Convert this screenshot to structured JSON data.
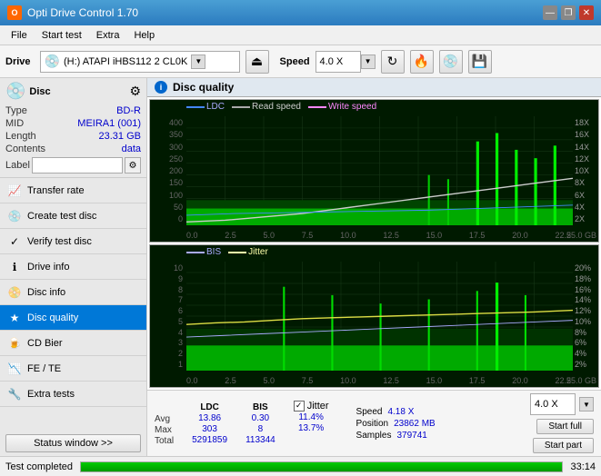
{
  "titlebar": {
    "title": "Opti Drive Control 1.70",
    "icon": "O",
    "min": "—",
    "max": "❐",
    "close": "✕"
  },
  "menubar": {
    "items": [
      "File",
      "Start test",
      "Extra",
      "Help"
    ]
  },
  "toolbar": {
    "drive_label": "Drive",
    "drive_value": "(H:) ATAPI iHBS112  2 CL0K",
    "drive_icon": "💿",
    "speed_label": "Speed",
    "speed_value": "4.0 X"
  },
  "sidebar": {
    "disc": {
      "header": "Disc",
      "rows": [
        {
          "label": "Type",
          "value": "BD-R"
        },
        {
          "label": "MID",
          "value": "MEIRA1 (001)"
        },
        {
          "label": "Length",
          "value": "23.31 GB"
        },
        {
          "label": "Contents",
          "value": "data"
        },
        {
          "label": "Label",
          "value": ""
        }
      ]
    },
    "nav_items": [
      {
        "id": "transfer-rate",
        "label": "Transfer rate",
        "icon": "📈"
      },
      {
        "id": "create-test-disc",
        "label": "Create test disc",
        "icon": "💿"
      },
      {
        "id": "verify-test-disc",
        "label": "Verify test disc",
        "icon": "✓"
      },
      {
        "id": "drive-info",
        "label": "Drive info",
        "icon": "ℹ"
      },
      {
        "id": "disc-info",
        "label": "Disc info",
        "icon": "📀"
      },
      {
        "id": "disc-quality",
        "label": "Disc quality",
        "icon": "★",
        "active": true
      },
      {
        "id": "cd-bier",
        "label": "CD Bier",
        "icon": "🍺"
      },
      {
        "id": "fe-te",
        "label": "FE / TE",
        "icon": "📉"
      },
      {
        "id": "extra-tests",
        "label": "Extra tests",
        "icon": "🔧"
      }
    ],
    "status_window_btn": "Status window >>"
  },
  "disc_quality": {
    "title": "Disc quality",
    "chart1": {
      "legend": [
        {
          "label": "LDC",
          "color": "#4488ff"
        },
        {
          "label": "Read speed",
          "color": "#aaaaaa"
        },
        {
          "label": "Write speed",
          "color": "#ff88ff"
        }
      ],
      "y_axis_left": [
        "400",
        "350",
        "300",
        "250",
        "200",
        "150",
        "100",
        "50",
        "0"
      ],
      "y_axis_right": [
        "18X",
        "16X",
        "14X",
        "12X",
        "10X",
        "8X",
        "6X",
        "4X",
        "2X"
      ],
      "x_axis": [
        "0.0",
        "2.5",
        "5.0",
        "7.5",
        "10.0",
        "12.5",
        "15.0",
        "17.5",
        "20.0",
        "22.5",
        "25.0"
      ],
      "x_unit": "GB"
    },
    "chart2": {
      "legend": [
        {
          "label": "BIS",
          "color": "#aaaaff"
        },
        {
          "label": "Jitter",
          "color": "#ffffaa"
        }
      ],
      "y_axis_left": [
        "10",
        "9",
        "8",
        "7",
        "6",
        "5",
        "4",
        "3",
        "2",
        "1"
      ],
      "y_axis_right": [
        "20%",
        "18%",
        "16%",
        "14%",
        "12%",
        "10%",
        "8%",
        "6%",
        "4%",
        "2%"
      ],
      "x_axis": [
        "0.0",
        "2.5",
        "5.0",
        "7.5",
        "10.0",
        "12.5",
        "15.0",
        "17.5",
        "20.0",
        "22.5",
        "25.0"
      ],
      "x_unit": "GB"
    },
    "stats": {
      "headers": [
        "LDC",
        "BIS",
        "Jitter"
      ],
      "avg_label": "Avg",
      "avg_ldc": "13.86",
      "avg_bis": "0.30",
      "avg_jitter": "11.4%",
      "max_label": "Max",
      "max_ldc": "303",
      "max_bis": "8",
      "max_jitter": "13.7%",
      "total_label": "Total",
      "total_ldc": "5291859",
      "total_bis": "113344",
      "jitter_checked": true,
      "jitter_label": "Jitter",
      "speed_label": "Speed",
      "speed_value": "4.18 X",
      "position_label": "Position",
      "position_value": "23862 MB",
      "samples_label": "Samples",
      "samples_value": "379741",
      "speed_select": "4.0 X",
      "start_full": "Start full",
      "start_part": "Start part"
    }
  },
  "statusbar": {
    "text": "Test completed",
    "progress": 100,
    "time": "33:14"
  }
}
